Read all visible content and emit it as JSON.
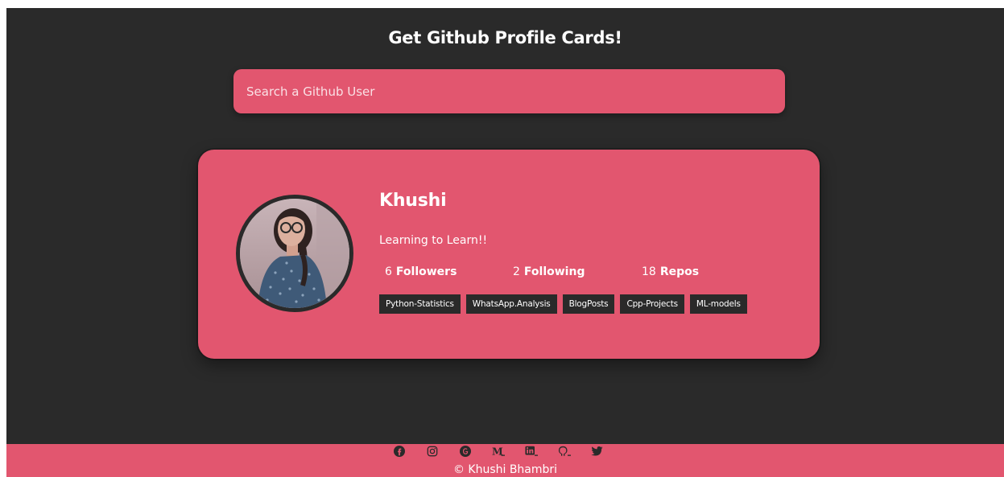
{
  "header": {
    "title": "Get Github Profile Cards!"
  },
  "search": {
    "placeholder": "Search a Github User",
    "value": ""
  },
  "profile": {
    "name": "Khushi",
    "bio": "Learning to Learn!!",
    "avatar_icon": "user-avatar-photo",
    "stats": [
      {
        "value": "6",
        "label": "Followers"
      },
      {
        "value": "2",
        "label": "Following"
      },
      {
        "value": "18",
        "label": "Repos"
      }
    ],
    "repos": [
      "Python-Statistics",
      "WhatsApp.Analysis",
      "BlogPosts",
      "Cpp-Projects",
      "ML-models"
    ]
  },
  "footer": {
    "social_icons": [
      "facebook-icon",
      "instagram-icon",
      "google-icon",
      "medium-icon",
      "linkedin-icon",
      "github-icon",
      "twitter-icon"
    ],
    "copyright": "© Khushi Bhambri"
  },
  "colors": {
    "background": "#2a2a2a",
    "accent": "#e2566f",
    "text": "#ffffff"
  }
}
